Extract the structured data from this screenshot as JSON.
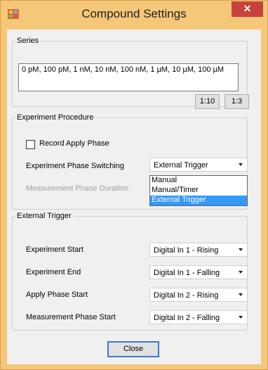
{
  "window": {
    "title": "Compound Settings",
    "close_glyph": "✕"
  },
  "series": {
    "legend": "Series",
    "value": "0 pM, 100 pM, 1 nM, 10 nM, 100 nM, 1 µM, 10 µM, 100 µM",
    "btn_1_10": "1:10",
    "btn_1_3": "1:3"
  },
  "procedure": {
    "legend": "Experiment Procedure",
    "record_apply_phase": {
      "label": "Record Apply Phase",
      "checked": false
    },
    "phase_switching": {
      "label": "Experiment Phase Switching",
      "value": "External Trigger"
    },
    "measurement_duration": {
      "label": "Measurement Phase Duration",
      "disabled": true
    },
    "dropdown_options": [
      "Manual",
      "Manual/Timer",
      "External Trigger"
    ],
    "dropdown_selected": "External Trigger"
  },
  "trigger": {
    "legend": "External Trigger",
    "experiment_start": {
      "label": "Experiment Start",
      "value": "Digital In 1 - Rising"
    },
    "experiment_end": {
      "label": "Experiment End",
      "value": "Digital In 1 - Falling"
    },
    "apply_phase_start": {
      "label": "Apply Phase Start",
      "value": "Digital In 2 - Rising"
    },
    "measurement_phase_start": {
      "label": "Measurement Phase Start",
      "value": "Digital In 2 - Falling"
    }
  },
  "footer": {
    "close_label": "Close"
  },
  "colors": {
    "frame": "#f5c779",
    "client": "#f0f0f0",
    "close_button": "#c7423c",
    "selection": "#3399ff"
  }
}
